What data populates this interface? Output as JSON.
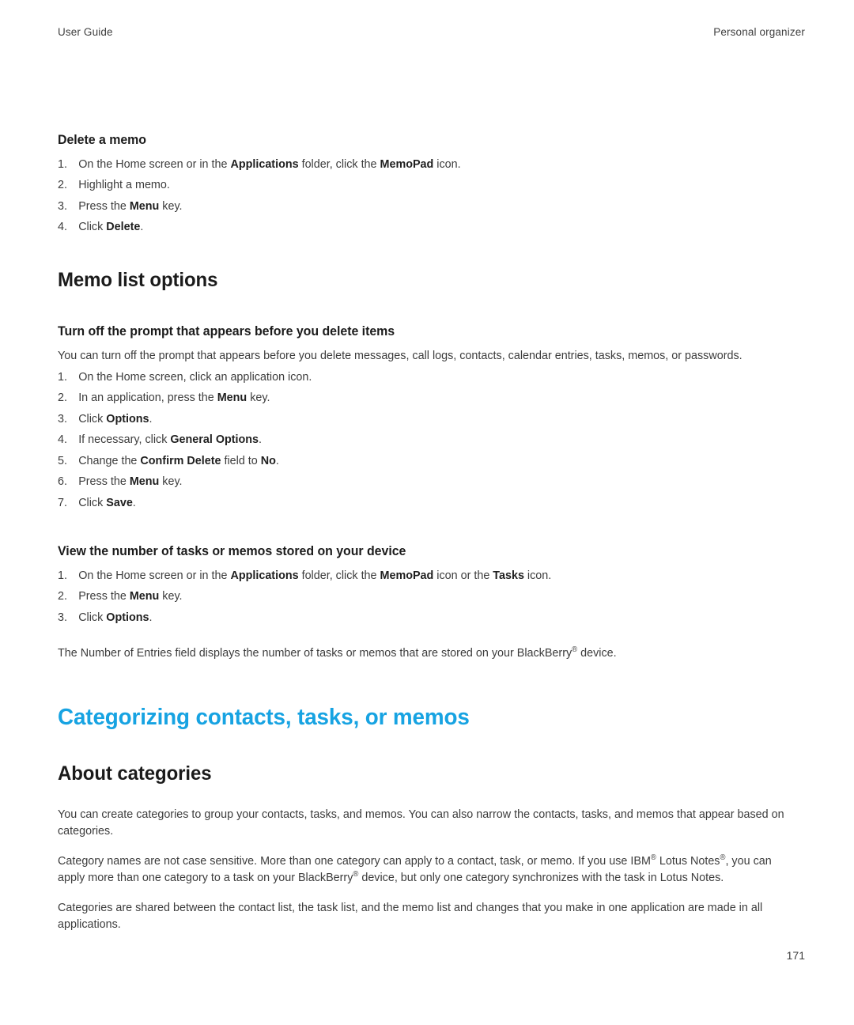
{
  "header": {
    "left": "User Guide",
    "right": "Personal organizer"
  },
  "colors": {
    "chapter_heading": "#17a3e2",
    "body_text": "#3c3c3c",
    "bold_text": "#1f1f1f",
    "page_background": "#ffffff"
  },
  "sections": [
    {
      "id": "delete-a-memo",
      "level": "sub",
      "heading": "Delete a memo",
      "steps": [
        {
          "num": "1.",
          "parts": [
            {
              "t": "On the Home screen or in the ",
              "b": false
            },
            {
              "t": "Applications",
              "b": true
            },
            {
              "t": " folder, click the ",
              "b": false
            },
            {
              "t": "MemoPad",
              "b": true
            },
            {
              "t": " icon.",
              "b": false
            }
          ]
        },
        {
          "num": "2.",
          "parts": [
            {
              "t": "Highlight a memo.",
              "b": false
            }
          ]
        },
        {
          "num": "3.",
          "parts": [
            {
              "t": "Press the ",
              "b": false
            },
            {
              "t": "Menu",
              "b": true
            },
            {
              "t": " key.",
              "b": false
            }
          ]
        },
        {
          "num": "4.",
          "parts": [
            {
              "t": "Click ",
              "b": false
            },
            {
              "t": "Delete",
              "b": true
            },
            {
              "t": ".",
              "b": false
            }
          ]
        }
      ]
    }
  ],
  "memo_list_options": {
    "heading": "Memo list options",
    "subsections": [
      {
        "id": "turn-off-prompt",
        "heading": "Turn off the prompt that appears before you delete items",
        "intro": "You can turn off the prompt that appears before you delete messages, call logs, contacts, calendar entries, tasks, memos, or passwords.",
        "steps": [
          {
            "num": "1.",
            "parts": [
              {
                "t": "On the Home screen, click an application icon.",
                "b": false
              }
            ]
          },
          {
            "num": "2.",
            "parts": [
              {
                "t": "In an application, press the ",
                "b": false
              },
              {
                "t": "Menu",
                "b": true
              },
              {
                "t": " key.",
                "b": false
              }
            ]
          },
          {
            "num": "3.",
            "parts": [
              {
                "t": "Click ",
                "b": false
              },
              {
                "t": "Options",
                "b": true
              },
              {
                "t": ".",
                "b": false
              }
            ]
          },
          {
            "num": "4.",
            "parts": [
              {
                "t": "If necessary, click ",
                "b": false
              },
              {
                "t": "General Options",
                "b": true
              },
              {
                "t": ".",
                "b": false
              }
            ]
          },
          {
            "num": "5.",
            "parts": [
              {
                "t": "Change the ",
                "b": false
              },
              {
                "t": "Confirm Delete",
                "b": true
              },
              {
                "t": " field to ",
                "b": false
              },
              {
                "t": "No",
                "b": true
              },
              {
                "t": ".",
                "b": false
              }
            ]
          },
          {
            "num": "6.",
            "parts": [
              {
                "t": "Press the ",
                "b": false
              },
              {
                "t": "Menu",
                "b": true
              },
              {
                "t": " key.",
                "b": false
              }
            ]
          },
          {
            "num": "7.",
            "parts": [
              {
                "t": "Click ",
                "b": false
              },
              {
                "t": "Save",
                "b": true
              },
              {
                "t": ".",
                "b": false
              }
            ]
          }
        ]
      },
      {
        "id": "view-number-of-tasks",
        "heading": "View the number of tasks or memos stored on your device",
        "steps": [
          {
            "num": "1.",
            "parts": [
              {
                "t": "On the Home screen or in the ",
                "b": false
              },
              {
                "t": "Applications",
                "b": true
              },
              {
                "t": " folder, click the ",
                "b": false
              },
              {
                "t": "MemoPad",
                "b": true
              },
              {
                "t": " icon or the ",
                "b": false
              },
              {
                "t": "Tasks",
                "b": true
              },
              {
                "t": " icon.",
                "b": false
              }
            ]
          },
          {
            "num": "2.",
            "parts": [
              {
                "t": "Press the ",
                "b": false
              },
              {
                "t": "Menu",
                "b": true
              },
              {
                "t": " key.",
                "b": false
              }
            ]
          },
          {
            "num": "3.",
            "parts": [
              {
                "t": "Click ",
                "b": false
              },
              {
                "t": "Options",
                "b": true
              },
              {
                "t": ".",
                "b": false
              }
            ]
          }
        ],
        "outro": "The Number of Entries field displays the number of tasks or memos that are stored on your BlackBerry® device."
      }
    ]
  },
  "categorizing": {
    "chapter_heading": "Categorizing contacts, tasks, or memos",
    "section_heading": "About categories",
    "paragraphs": [
      "You can create categories to group your contacts, tasks, and memos. You can also narrow the contacts, tasks, and memos that appear based on categories.",
      "Category names are not case sensitive. More than one category can apply to a contact, task, or memo. If you use IBM® Lotus Notes®, you can apply more than one category to a task on your BlackBerry® device, but only one category synchronizes with the task in Lotus Notes.",
      "Categories are shared between the contact list, the task list, and the memo list and changes that you make in one application are made in all applications."
    ]
  },
  "footer": {
    "page_number": "171"
  }
}
